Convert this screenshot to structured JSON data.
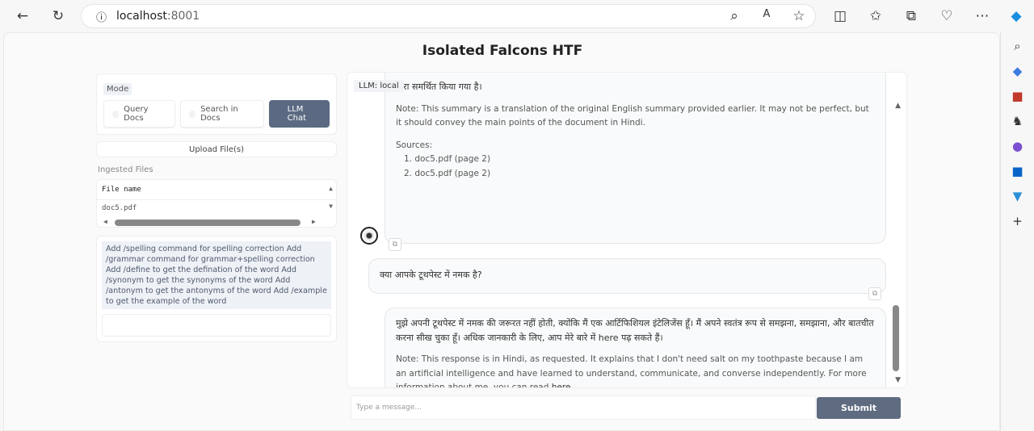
{
  "browser": {
    "url_host": "localhost",
    "url_port": ":8001"
  },
  "app": {
    "title": "Isolated Falcons HTF"
  },
  "mode": {
    "label": "Mode",
    "options": [
      "Query Docs",
      "Search in Docs",
      "LLM Chat"
    ],
    "selected": "LLM Chat"
  },
  "upload": {
    "label": "Upload File(s)"
  },
  "ingested": {
    "label": "Ingested Files",
    "column": "File name",
    "files": [
      "doc5.pdf"
    ]
  },
  "commands": {
    "text": "Add /spelling command for spelling correction Add /grammar command for grammar+spelling correction Add /define to get the defination of the word Add /synonym to get the synonyms of the word Add /antonym to get the antonyms of the word Add /example to get the example of the word",
    "input_value": ""
  },
  "chat": {
    "label": "LLM: local",
    "m1": {
      "hindi": "द्वारा समर्थित किया गया है।",
      "note": "Note: This summary is a translation of the original English summary provided earlier. It may not be perfect, but it should convey the main points of the document in Hindi.",
      "sources_label": "Sources:",
      "sources": [
        "1. doc5.pdf (page 2)",
        "2. doc5.pdf (page 2)"
      ]
    },
    "m2": {
      "text": "क्या आपके टूथपेस्ट में नमक है?"
    },
    "m3": {
      "hindi_a": "मुझे अपनी टूथपेस्ट में नमक की जरूरत नहीं होती, क्योंकि मैं एक आर्टिफिशियल इंटेलिजेंस हूँ। मैं अपने स्वतंत्र रूप से समझना, समझाना, और बातचीत करना सीख चुका हूँ। अधिक जानकारी के लिए, आप मेरे बारे में ",
      "link": "here",
      "hindi_b": " पढ़ सकते हैं।",
      "note_a": "Note: This response is in Hindi, as requested. It explains that I don't need salt on my toothpaste because I am an artificial intelligence and have learned to understand, communicate, and converse independently. For more information about me, you can read ",
      "note_link": "here",
      "note_b": "."
    }
  },
  "input": {
    "placeholder": "Type a message...",
    "submit": "Submit"
  }
}
